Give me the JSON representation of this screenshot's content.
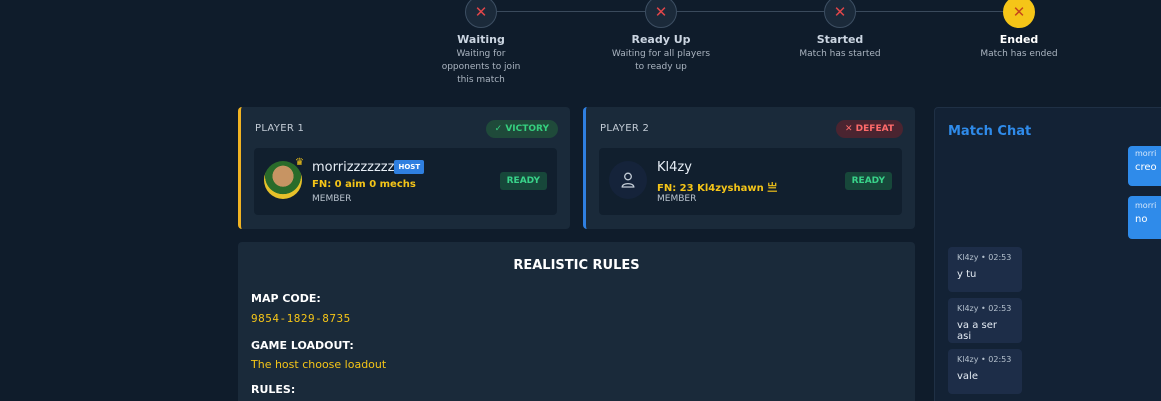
{
  "steps": [
    {
      "title": "Waiting",
      "desc": "Waiting for opponents to join this match",
      "icon": "x-icon",
      "state": "incomplete"
    },
    {
      "title": "Ready Up",
      "desc": "Waiting for all players to ready up",
      "icon": "x-icon",
      "state": "incomplete"
    },
    {
      "title": "Started",
      "desc": "Match has started",
      "icon": "x-icon",
      "state": "incomplete"
    },
    {
      "title": "Ended",
      "desc": "Match has ended",
      "icon": "x-icon",
      "state": "active"
    }
  ],
  "players": [
    {
      "label": "PLAYER 1",
      "result": "VICTORY",
      "result_icon": "✓",
      "name": "morrizzzzzzz",
      "host_badge": "HOST",
      "fn": "FN: 0 aim 0 mechs",
      "role": "MEMBER",
      "status": "READY"
    },
    {
      "label": "PLAYER 2",
      "result": "DEFEAT",
      "result_icon": "✕",
      "name": "Kl4zy",
      "fn": "FN: 23 Kl4zyshawn 亗",
      "role": "MEMBER",
      "status": "READY"
    }
  ],
  "rules": {
    "title": "REALISTIC RULES",
    "map_code_label": "MAP CODE:",
    "map_code": "9854-1829-8735",
    "loadout_label": "GAME LOADOUT:",
    "loadout": "The host choose loadout",
    "rules_label": "RULES:"
  },
  "chat": {
    "title": "Match Chat",
    "outgoing": [
      {
        "meta": "morri",
        "text": "creo"
      },
      {
        "meta": "morri",
        "text": "no"
      }
    ],
    "incoming": [
      {
        "meta": "Kl4zy • 02:53",
        "text": "y tu"
      },
      {
        "meta": "Kl4zy • 02:53",
        "text": "va a ser asi"
      },
      {
        "meta": "Kl4zy • 02:53",
        "text": "vale"
      }
    ]
  },
  "colors": {
    "background": "#0f1c2b",
    "card": "#1a2a3a",
    "accent_gold": "#f5c518",
    "accent_blue": "#2f7fe0",
    "victory": "#35d07f",
    "defeat": "#ff6b6b"
  }
}
